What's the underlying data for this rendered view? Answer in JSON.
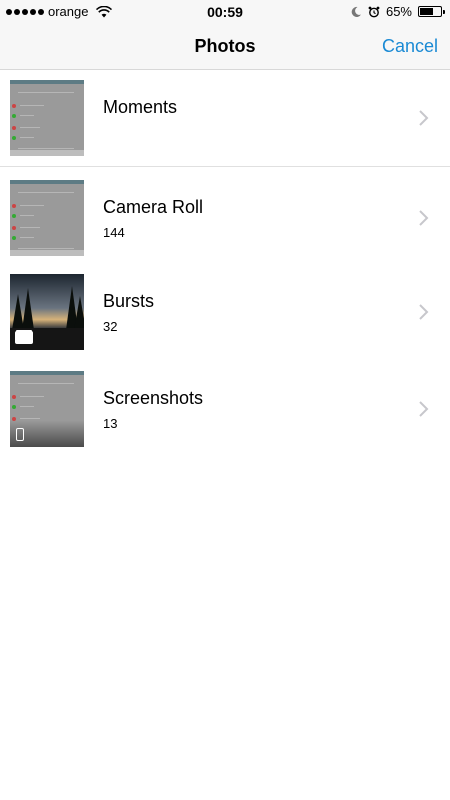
{
  "status_bar": {
    "carrier": "orange",
    "time": "00:59",
    "battery": "65%",
    "battery_level": 0.65,
    "icons": [
      "signal-dots-icon",
      "wifi-icon",
      "moon-icon",
      "alarm-icon",
      "battery-icon"
    ]
  },
  "nav": {
    "title": "Photos",
    "cancel_label": "Cancel",
    "accent_color": "#1a8ad4"
  },
  "albums": [
    {
      "title": "Moments",
      "count": ""
    },
    {
      "title": "Camera Roll",
      "count": "144"
    },
    {
      "title": "Bursts",
      "count": "32"
    },
    {
      "title": "Screenshots",
      "count": "13"
    }
  ]
}
